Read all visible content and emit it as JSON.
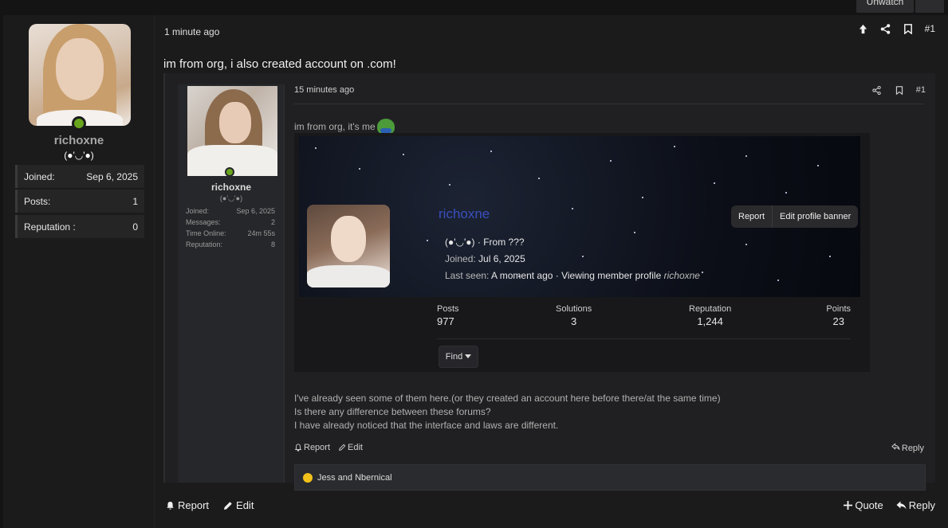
{
  "topbar": {
    "unwatch_label": "Unwatch"
  },
  "post": {
    "author": {
      "name": "richoxne",
      "title": "(●'◡'●)",
      "stats": [
        {
          "label": "Joined:",
          "value": "Sep 6, 2025"
        },
        {
          "label": "Posts:",
          "value": "1"
        },
        {
          "label": "Reputation :",
          "value": "0"
        }
      ]
    },
    "time": "1 minute ago",
    "number": "#1",
    "text": "im from org, i also created account on .com!",
    "footer": {
      "report": "Report",
      "edit": "Edit",
      "quote": "Quote",
      "reply": "Reply"
    }
  },
  "quoted": {
    "author": {
      "name": "richoxne",
      "title": "(●'◡'●)",
      "stats": [
        {
          "label": "Joined:",
          "value": "Sep 6, 2025"
        },
        {
          "label": "Messages:",
          "value": "2"
        },
        {
          "label": "Time Online:",
          "value": "24m 55s"
        },
        {
          "label": "Reputation:",
          "value": "8"
        }
      ]
    },
    "time": "15 minutes ago",
    "number": "#1",
    "lead": "im from org, it's me",
    "profile_card": {
      "name": "richoxne",
      "buttons": [
        "Report",
        "Edit profile banner"
      ],
      "title_from": "(●'◡'●) · From ???",
      "joined_label": "Joined:",
      "joined_value": "Jul 6, 2025",
      "lastseen_label": "Last seen:",
      "lastseen_value": "A moment ago · Viewing member profile",
      "lastseen_user": "richoxne",
      "stats": [
        {
          "label": "Posts",
          "value": "977"
        },
        {
          "label": "Solutions",
          "value": "3"
        },
        {
          "label": "Reputation",
          "value": "1,244"
        },
        {
          "label": "Points",
          "value": "23"
        }
      ],
      "find_label": "Find"
    },
    "body": [
      "I've already seen some of them here.(or they created an account here before there/at the same time)",
      "Is there any difference between these forums?",
      "I have already noticed that the interface and laws are different."
    ],
    "footer": {
      "report": "Report",
      "edit": "Edit",
      "reply": "Reply"
    },
    "reactions": "Jess and Nbernical"
  },
  "colors": {
    "online": "#6aa51e",
    "profile_name": "#3a4fbf",
    "reaction_badge": "#f2c21b"
  }
}
